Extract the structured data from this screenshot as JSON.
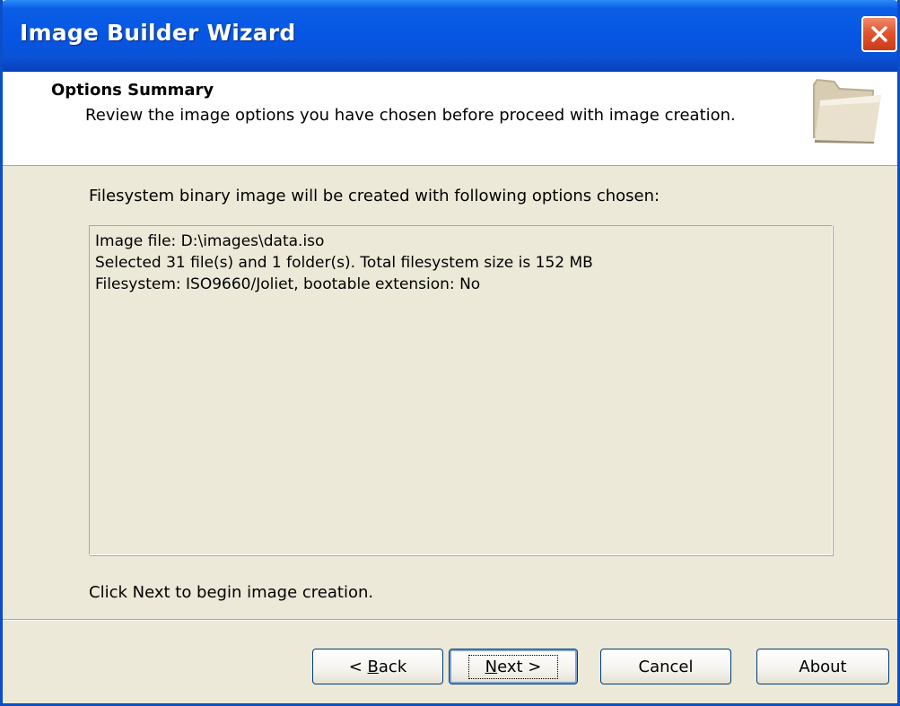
{
  "window": {
    "title": "Image Builder Wizard"
  },
  "header": {
    "title": "Options Summary",
    "subtitle": "Review the image options you have chosen before proceed with image creation."
  },
  "main": {
    "intro": "Filesystem binary image will be created with following options chosen:",
    "summary_lines": [
      "Image file: D:\\images\\data.iso",
      "Selected 31 file(s) and 1 folder(s). Total filesystem size is 152 MB",
      "Filesystem: ISO9660/Joliet, bootable extension: No"
    ],
    "hint": "Click Next to begin image creation."
  },
  "buttons": {
    "back_prefix": "< ",
    "back_mnemonic": "B",
    "back_rest": "ack",
    "next_mnemonic": "N",
    "next_rest": "ext >",
    "cancel": "Cancel",
    "about": "About"
  },
  "icons": {
    "close": "close-icon",
    "header": "folder-icon"
  },
  "colors": {
    "title_bar": "#0656e3",
    "close_button": "#e2552e",
    "dialog_background": "#ece9d8"
  }
}
